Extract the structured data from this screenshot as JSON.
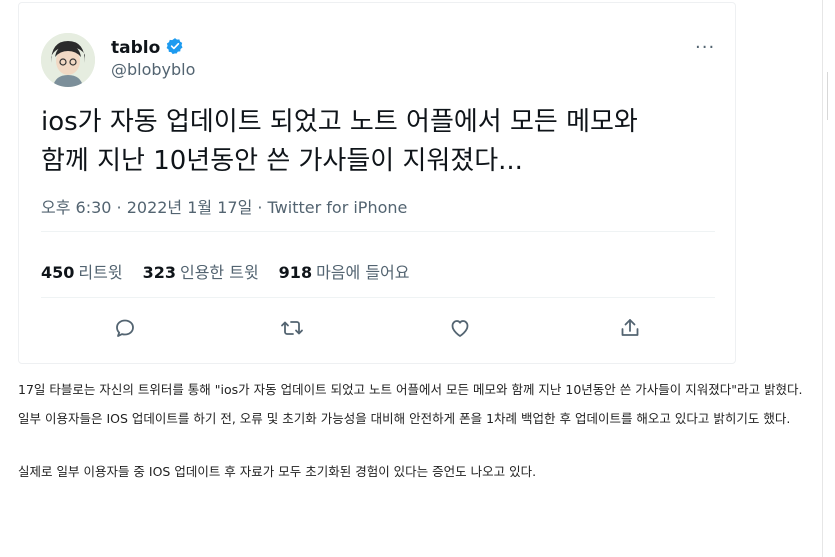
{
  "tweet": {
    "name": "tablo",
    "handle": "@blobyblo",
    "more": "···",
    "text": "ios가 자동 업데이트 되었고 노트 어플에서 모든 메모와\n함께 지난 10년동안 쓴 가사들이 지워졌다...",
    "meta": "오후 6:30 · 2022년 1월 17일 · Twitter for iPhone",
    "stats": {
      "retweets_num": "450",
      "retweets_label": "리트윗",
      "quotes_num": "323",
      "quotes_label": "인용한 트윗",
      "likes_num": "918",
      "likes_label": "마음에 들어요"
    },
    "accent_color": "#1d9bf0",
    "icons": [
      "verified-badge-icon",
      "reply-icon",
      "retweet-icon",
      "like-icon",
      "share-icon",
      "more-icon"
    ]
  },
  "article": {
    "p1": "17일 타블로는 자신의 트위터를 통해 \"ios가 자동 업데이트 되었고 노트 어플에서 모든 메모와 함께 지난 10년동안 쓴 가사들이 지워졌다\"라고 밝혔다.",
    "p2": "일부 이용자들은 IOS 업데이트를 하기 전, 오류 및 초기화 가능성을 대비해 안전하게 폰을 1차례 백업한 후 업데이트를 해오고 있다고 밝히기도 했다.",
    "p3": "실제로 일부 이용자들 중 IOS 업데이트 후 자료가 모두 초기화된 경험이 있다는 증언도 나오고 있다."
  }
}
